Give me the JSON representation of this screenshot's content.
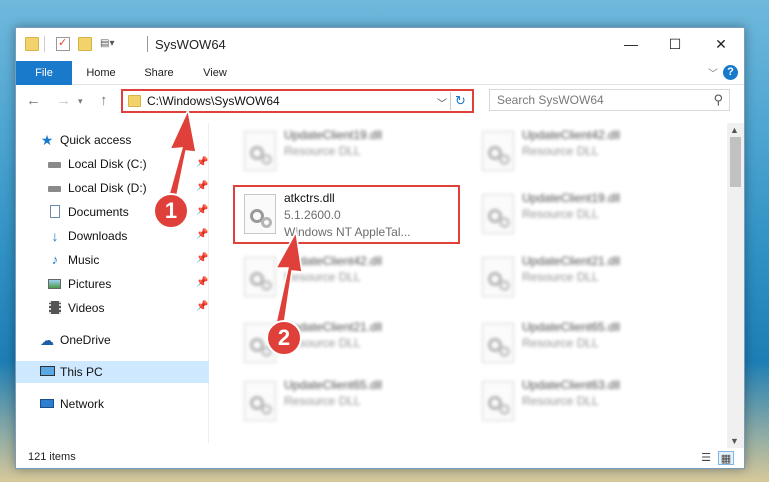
{
  "window": {
    "title": "SysWOW64",
    "controls": {
      "minimize": "—",
      "maximize": "☐",
      "close": "✕"
    }
  },
  "ribbon": {
    "tabs": [
      "File",
      "Home",
      "Share",
      "View"
    ],
    "help": "?"
  },
  "navigation": {
    "address": "C:\\Windows\\SysWOW64",
    "search_placeholder": "Search SysWOW64"
  },
  "sidebar": {
    "items": [
      {
        "label": "Quick access",
        "icon": "star-icon"
      },
      {
        "label": "Local Disk (C:)",
        "icon": "drive-icon"
      },
      {
        "label": "Local Disk (D:)",
        "icon": "drive-icon"
      },
      {
        "label": "Documents",
        "icon": "documents-icon"
      },
      {
        "label": "Downloads",
        "icon": "download-icon"
      },
      {
        "label": "Music",
        "icon": "music-icon"
      },
      {
        "label": "Pictures",
        "icon": "pictures-icon"
      },
      {
        "label": "Videos",
        "icon": "videos-icon"
      },
      {
        "label": "OneDrive",
        "icon": "cloud-icon"
      },
      {
        "label": "This PC",
        "icon": "computer-icon"
      },
      {
        "label": "Network",
        "icon": "network-icon"
      }
    ]
  },
  "files": {
    "col1": [
      {
        "name": "UpdateClient19.dll",
        "type": "Resource DLL"
      },
      {
        "name": "atkctrs.dll",
        "version": "5.1.2600.0",
        "desc": "Windows NT AppleTal..."
      },
      {
        "name": "UpdateClient42.dll",
        "type": "Resource DLL"
      },
      {
        "name": "UpdateClient21.dll",
        "type": "Resource DLL"
      },
      {
        "name": "UpdateClient65.dll",
        "type": "Resource DLL"
      }
    ],
    "col2": [
      {
        "name": "UpdateClient42.dll",
        "type": "Resource DLL"
      },
      {
        "name": "UpdateClient19.dll",
        "type": "Resource DLL"
      },
      {
        "name": "UpdateClient21.dll",
        "type": "Resource DLL"
      },
      {
        "name": "UpdateClient65.dll",
        "type": "Resource DLL"
      },
      {
        "name": "UpdateClient63.dll",
        "type": "Resource DLL"
      }
    ]
  },
  "status": {
    "count": "121 items"
  },
  "annotations": {
    "marker1": "1",
    "marker2": "2",
    "color": "#e0403a"
  }
}
